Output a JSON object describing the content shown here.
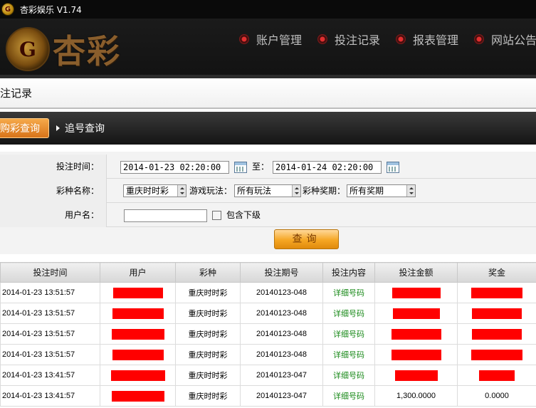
{
  "window": {
    "title": "杏彩娱乐 V1.74",
    "app_icon_glyph": "G"
  },
  "header": {
    "logo_glyph": "G",
    "logo_text": "杏彩",
    "nav": [
      "账户管理",
      "投注记录",
      "报表管理",
      "网站公告"
    ]
  },
  "page": {
    "title": "注记录"
  },
  "tabs": {
    "active": "购彩查询",
    "other": "追号查询"
  },
  "form": {
    "time_label": "投注时间：",
    "start_time": "2014-01-23 02:20:00",
    "to_label": "至：",
    "end_time": "2014-01-24 02:20:00",
    "lottery_label": "彩种名称：",
    "lottery_value": "重庆时时彩",
    "play_label": "游戏玩法：",
    "play_value": "所有玩法",
    "period_label": "彩种奖期：",
    "period_value": "所有奖期",
    "user_label": "用户名：",
    "user_value": "",
    "include_sub_label": "包含下级",
    "query_label": "查询"
  },
  "table": {
    "columns": [
      "投注时间",
      "用户",
      "彩种",
      "投注期号",
      "投注内容",
      "投注金额",
      "奖金"
    ],
    "rows": [
      {
        "time": "2014-01-23 13:51:57",
        "lottery": "重庆时时彩",
        "period": "20140123-048",
        "content": "详细号码",
        "amount": "",
        "prize": ""
      },
      {
        "time": "2014-01-23 13:51:57",
        "lottery": "重庆时时彩",
        "period": "20140123-048",
        "content": "详细号码",
        "amount": "",
        "prize": ""
      },
      {
        "time": "2014-01-23 13:51:57",
        "lottery": "重庆时时彩",
        "period": "20140123-048",
        "content": "详细号码",
        "amount": "",
        "prize": ""
      },
      {
        "time": "2014-01-23 13:51:57",
        "lottery": "重庆时时彩",
        "period": "20140123-048",
        "content": "详细号码",
        "amount": "",
        "prize": ""
      },
      {
        "time": "2014-01-23 13:41:57",
        "lottery": "重庆时时彩",
        "period": "20140123-047",
        "content": "详细号码",
        "amount": "",
        "prize": ""
      },
      {
        "time": "2014-01-23 13:41:57",
        "lottery": "重庆时时彩",
        "period": "20140123-047",
        "content": "详细号码",
        "amount": "1,300.0000",
        "prize": "0.0000"
      }
    ]
  },
  "colors": {
    "redaction": "#ff0000",
    "accent_orange": "#f5a623",
    "detail_link": "#1a8a1a"
  }
}
